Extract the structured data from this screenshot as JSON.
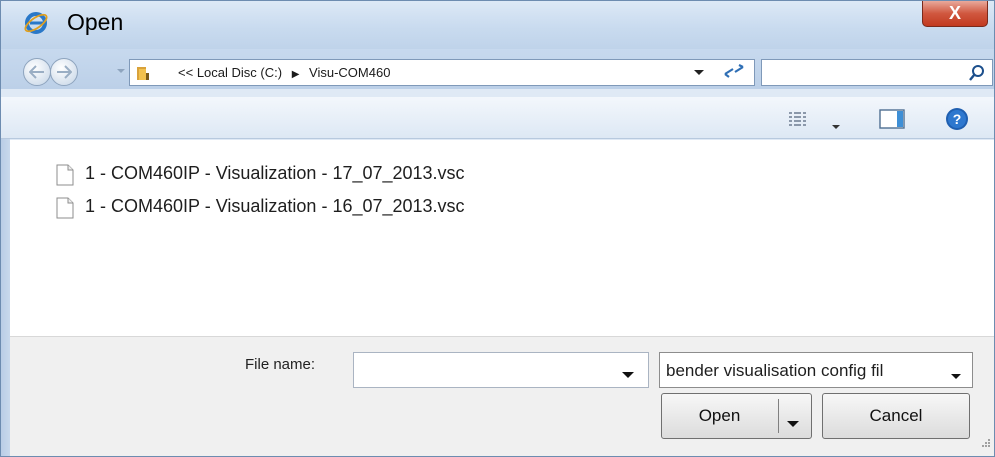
{
  "window": {
    "title": "Open",
    "close_label": "X"
  },
  "address_bar": {
    "breadcrumb_prefix": "<<",
    "segments": [
      "Local Disc (C:)",
      "Visu-COM460"
    ]
  },
  "search": {
    "placeholder": ""
  },
  "files": [
    {
      "name": "1 - COM460IP - Visualization - 17_07_2013.vsc"
    },
    {
      "name": "1 - COM460IP - Visualization - 16_07_2013.vsc"
    }
  ],
  "bottom": {
    "file_name_label": "File name:",
    "file_name_value": "",
    "file_type_selected": "bender visualisation config fil",
    "open_label": "Open",
    "cancel_label": "Cancel"
  },
  "colors": {
    "close_button": "#c23a20",
    "title_bar": "#c9dbef",
    "content_bg": "#ffffff",
    "bottom_bg": "#f0f0f0"
  },
  "icons": {
    "title": "internet-explorer-icon",
    "back": "back-arrow-icon",
    "forward": "forward-arrow-icon",
    "folder": "folder-icon",
    "refresh": "refresh-icon",
    "search": "search-icon",
    "views": "views-icon",
    "preview": "preview-pane-icon",
    "help": "help-icon",
    "file": "document-icon"
  }
}
